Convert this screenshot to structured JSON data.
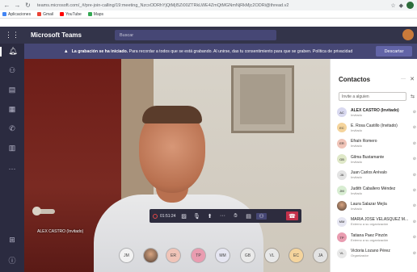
{
  "browser": {
    "url": "teams.microsoft.com/_#/pre-join-calling/19:meeting_NzcxODRhYjQtMjI5Zi00ZTRkLWE4ZmQtMGNmNjRkMjc2ODRi@thread.v2",
    "bookmarks": [
      "Aplicaciones",
      "Gmail",
      "YouTube",
      "Maps"
    ]
  },
  "teams": {
    "app_title": "Microsoft Teams",
    "search_placeholder": "Buscar"
  },
  "banner": {
    "bold_text": "La grabación se ha iniciado.",
    "text": " Para recordar a todos que se está grabando. Al unirse, das tu consentimiento para que se graben. Política de privacidad",
    "dismiss_label": "Descartar"
  },
  "video": {
    "speaker_name": "ALEX CASTRO (Invitado)"
  },
  "controls": {
    "timer": "01:51:24"
  },
  "participants": [
    {
      "initials": "JM",
      "color": "#f2f2f2",
      "fg": "#444"
    },
    {
      "initials": "",
      "color": "#8a6a55",
      "fg": "#fff",
      "photo": true
    },
    {
      "initials": "ER",
      "color": "#f0c4b8",
      "fg": "#444"
    },
    {
      "initials": "TP",
      "color": "#e99cb0",
      "fg": "#444"
    },
    {
      "initials": "MM",
      "color": "#e6e6f2",
      "fg": "#444"
    },
    {
      "initials": "GB",
      "color": "#eaeaea",
      "fg": "#444"
    },
    {
      "initials": "VL",
      "color": "#e8e8e8",
      "fg": "#444"
    },
    {
      "initials": "EC",
      "color": "#f5d49c",
      "fg": "#444"
    },
    {
      "initials": "JA",
      "color": "#e3e3e3",
      "fg": "#444"
    }
  ],
  "contacts_panel": {
    "title": "Contactos",
    "invite_placeholder": "Invite a alguien",
    "contacts": [
      {
        "initials": "AC",
        "color": "#d9d9f0",
        "name": "ALEX CASTRO (Invitado)",
        "role": "Invitado",
        "bold": true
      },
      {
        "initials": "EC",
        "color": "#f5d49c",
        "name": "E. Rosa Castillo (Invitado)",
        "role": "Invitado",
        "bold": false
      },
      {
        "initials": "ER",
        "color": "#f0c4b8",
        "name": "Efraín Romero",
        "role": "Invitado",
        "bold": false
      },
      {
        "initials": "GB",
        "color": "#dfe8c8",
        "name": "Gilma Bustamante",
        "role": "Invitado",
        "bold": false
      },
      {
        "initials": "JA",
        "color": "#e3e3e3",
        "name": "Juan Carlos Arévalo",
        "role": "Invitado",
        "bold": false
      },
      {
        "initials": "JM",
        "color": "#d8edd2",
        "name": "Judith Caballero Méndez",
        "role": "Invitado",
        "bold": false
      },
      {
        "initials": "",
        "color": "#8a6a55",
        "name": "Laura Salazar Mejía",
        "role": "Invitado",
        "bold": false
      },
      {
        "initials": "MM",
        "color": "#e6e6f2",
        "name": "MARIA JOSE VELASQUEZ M...",
        "role": "Externo a su organización",
        "bold": false
      },
      {
        "initials": "TP",
        "color": "#e99cb0",
        "name": "Tatiana Paez Pinzón",
        "role": "Externo a su organización",
        "bold": false
      },
      {
        "initials": "VL",
        "color": "#e8e8e8",
        "name": "Victoria Lozano Pérez",
        "role": "Organizador",
        "bold": false
      }
    ]
  }
}
